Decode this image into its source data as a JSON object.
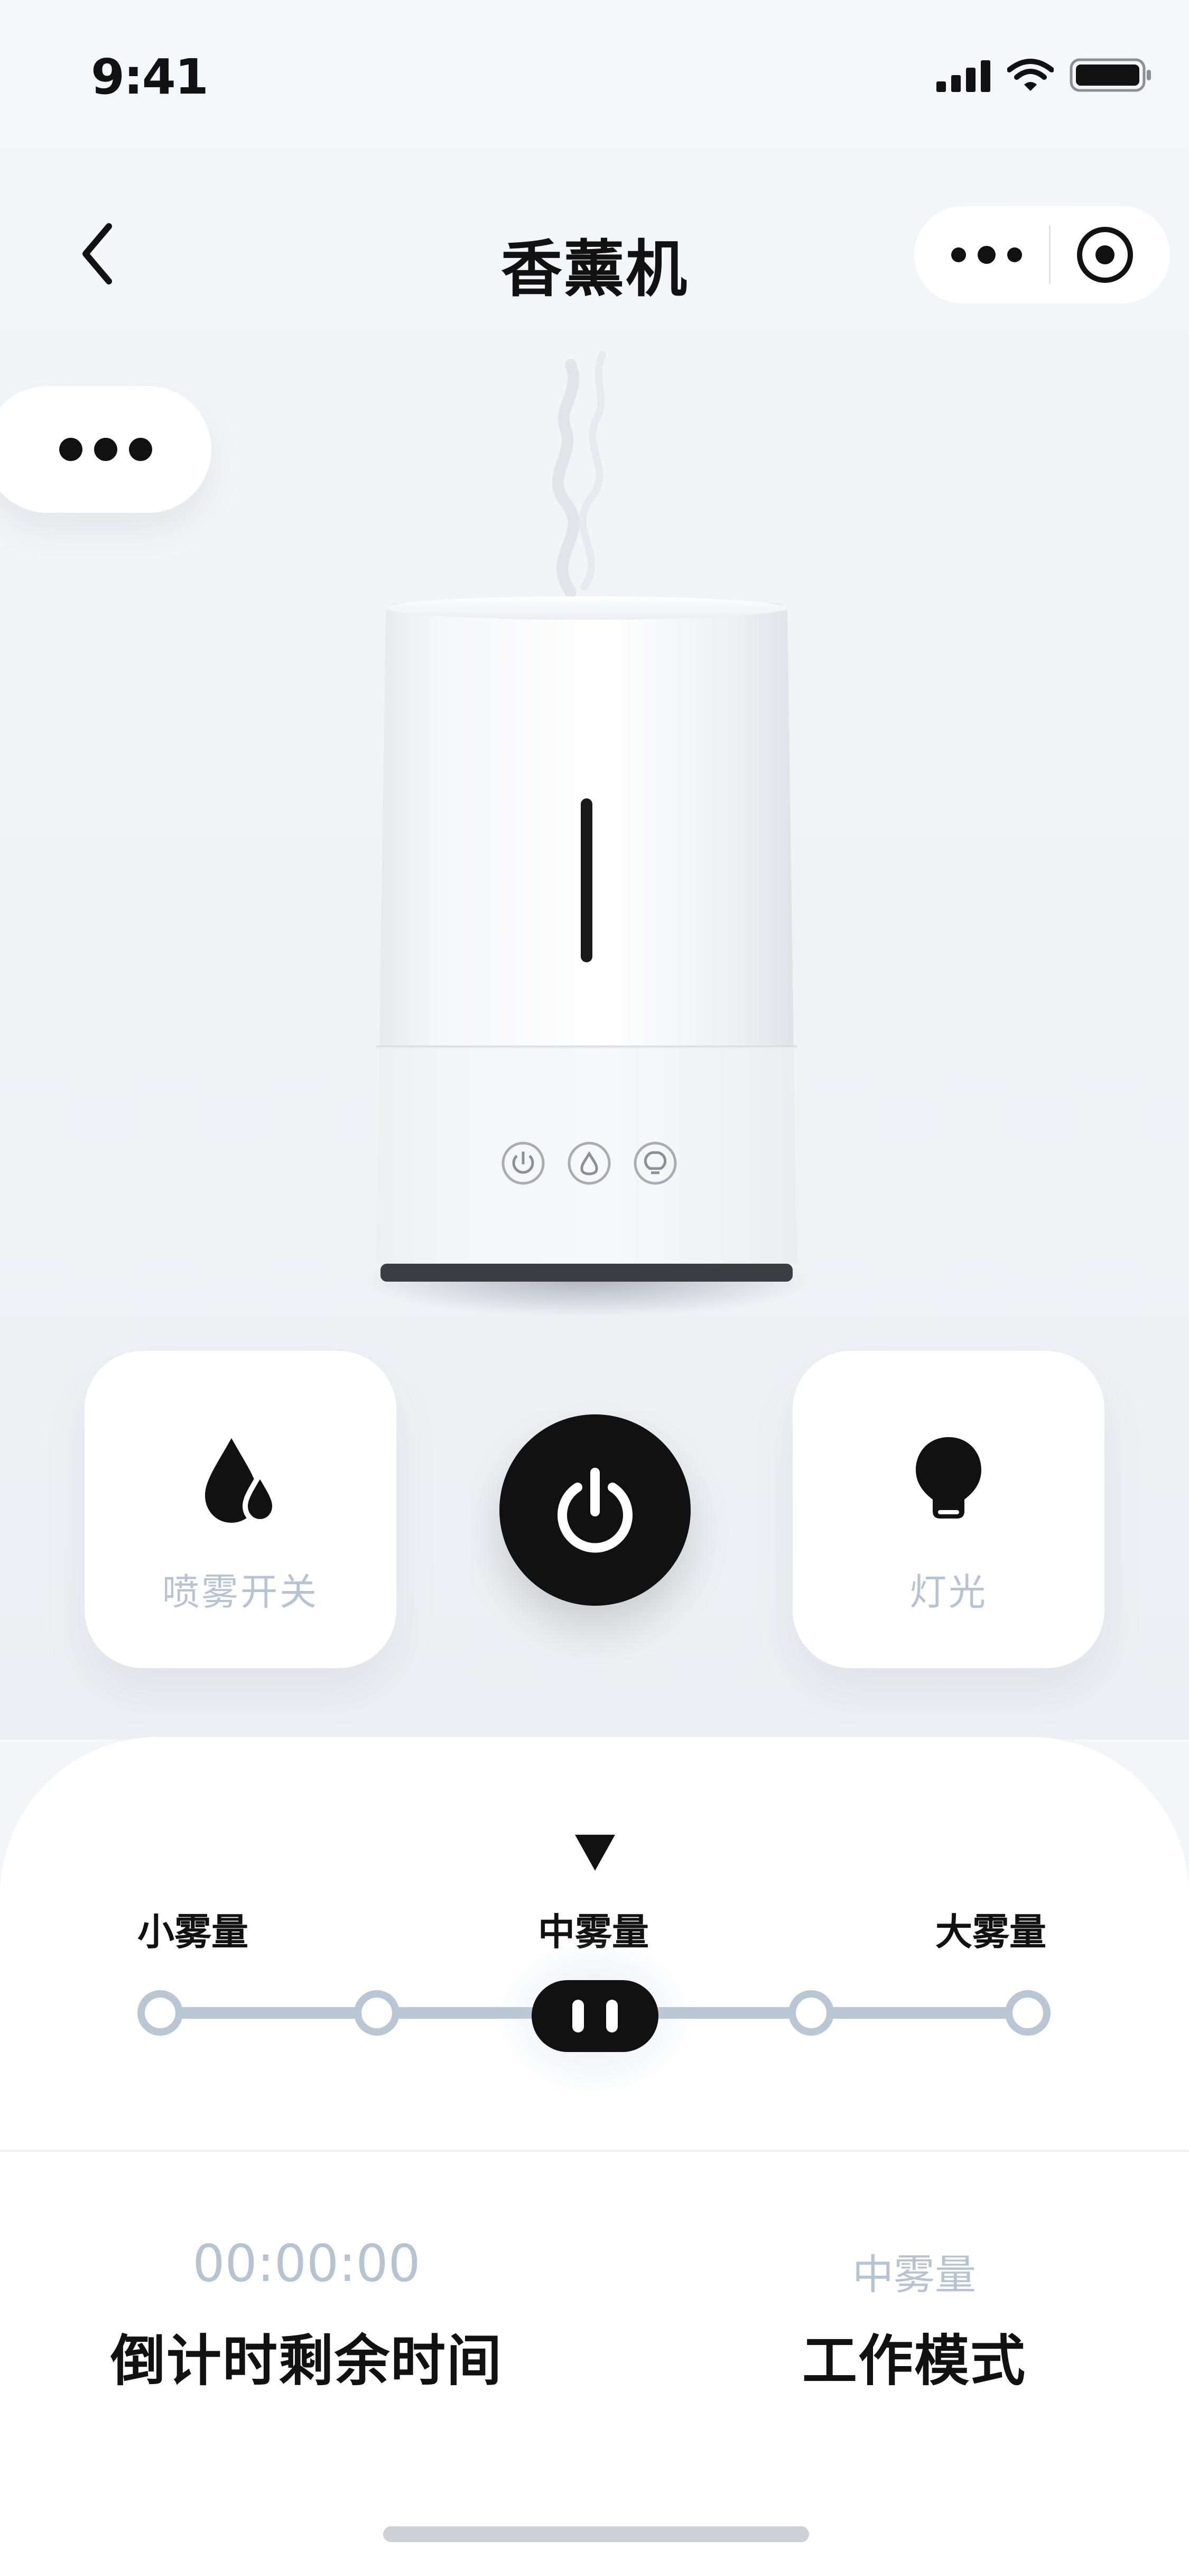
{
  "status_bar": {
    "time": "9:41"
  },
  "nav": {
    "title": "香薰机"
  },
  "controls": {
    "spray_label": "喷雾开关",
    "light_label": "灯光"
  },
  "mist_levels": {
    "labels": [
      "小雾量",
      "中雾量",
      "大雾量"
    ],
    "selected": "中雾量"
  },
  "info": {
    "countdown_value": "00:00:00",
    "countdown_label": "倒计时剩余时间",
    "mode_value": "中雾量",
    "mode_label": "工作模式"
  },
  "colors": {
    "accent": "#111111",
    "muted_text": "#b5c3d2",
    "track": "#b9c6d3"
  }
}
